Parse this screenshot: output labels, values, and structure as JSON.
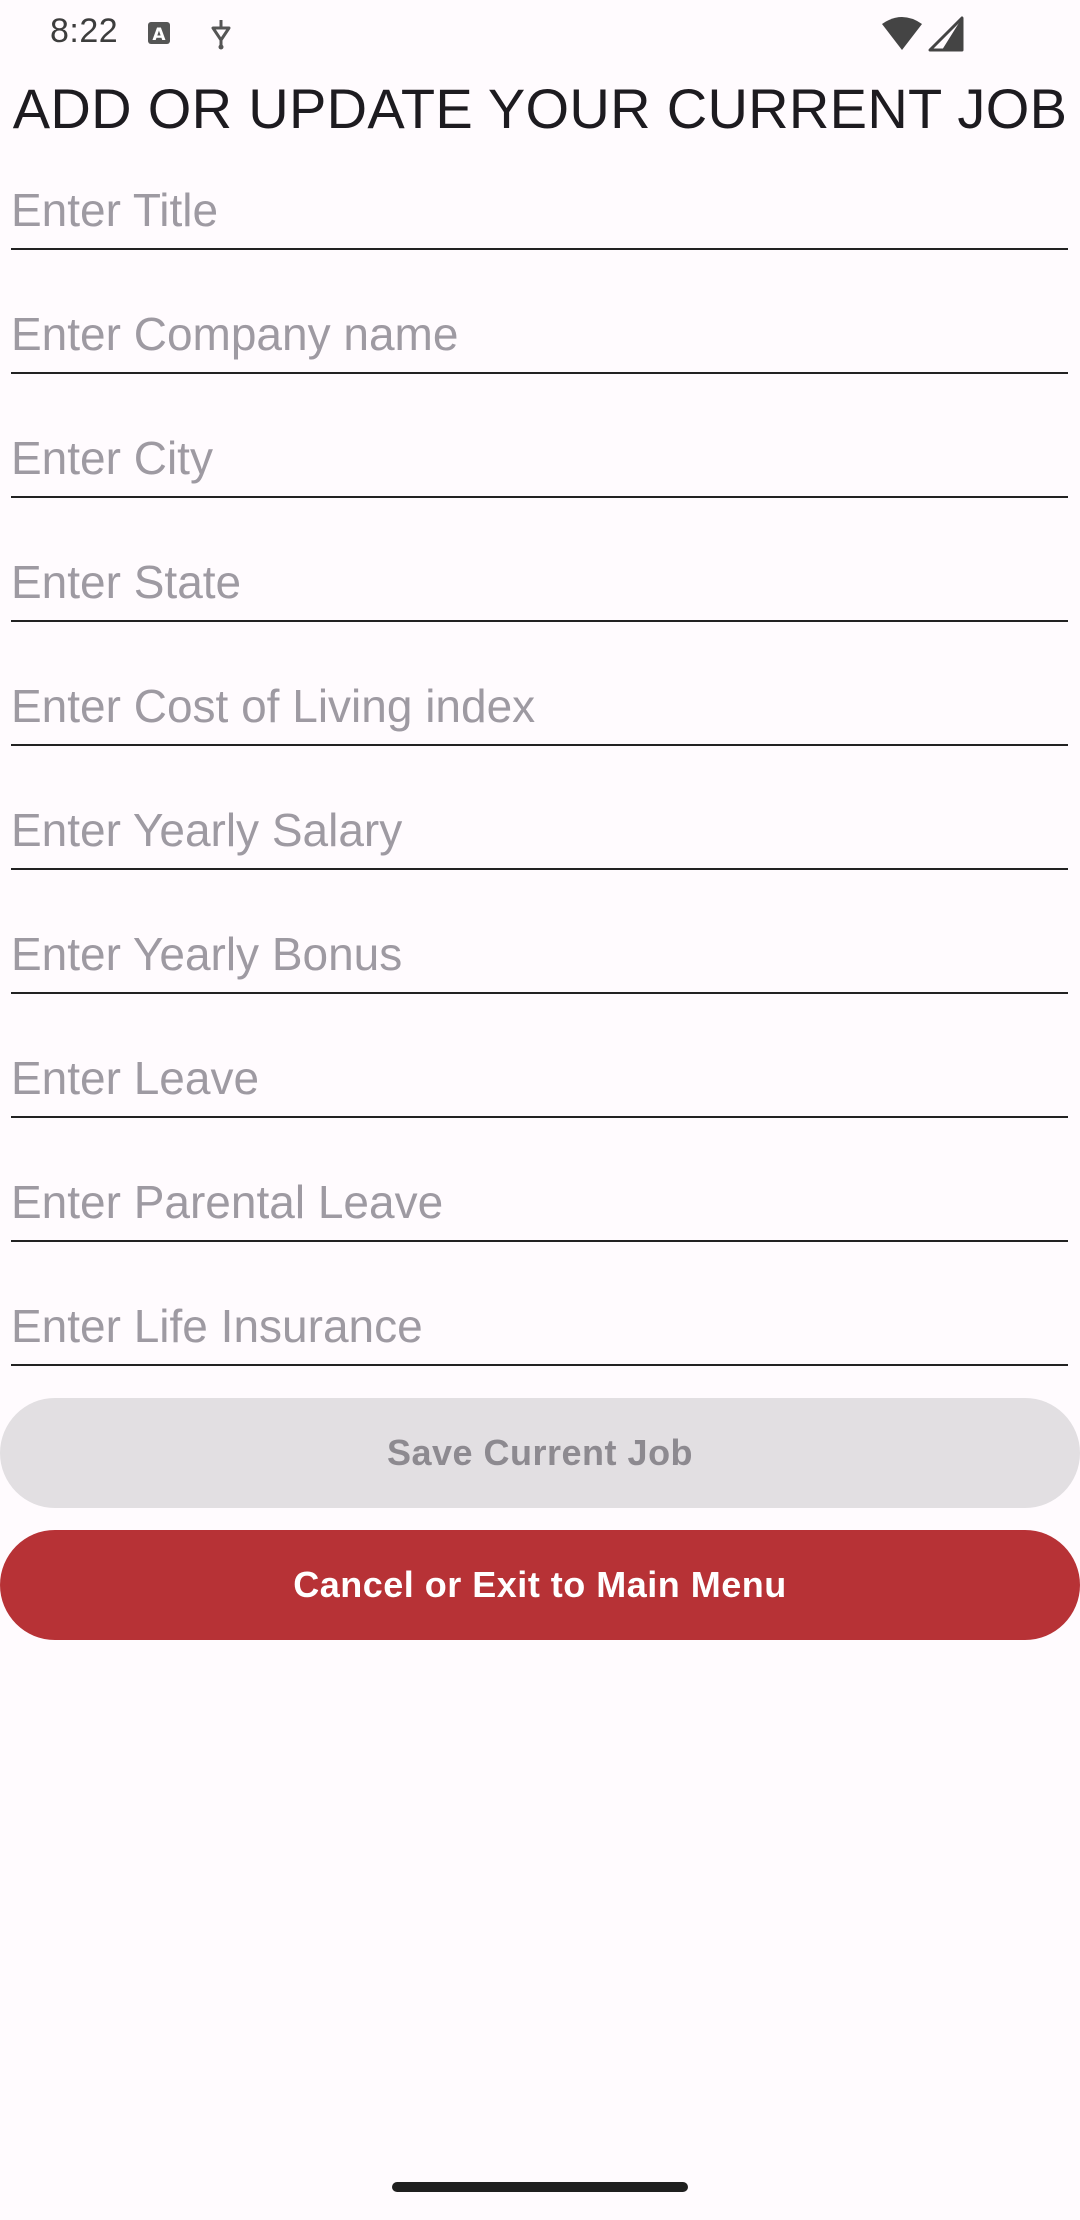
{
  "status_bar": {
    "time": "8:22",
    "icons": [
      "font-a-icon",
      "usb-debug-icon",
      "wifi-icon",
      "signal-icon"
    ]
  },
  "page": {
    "title": "ADD OR UPDATE YOUR CURRENT JOB"
  },
  "form": {
    "title": {
      "placeholder": "Enter Title",
      "value": ""
    },
    "company": {
      "placeholder": "Enter Company name",
      "value": ""
    },
    "city": {
      "placeholder": "Enter City",
      "value": ""
    },
    "state": {
      "placeholder": "Enter State",
      "value": ""
    },
    "cost_of_living": {
      "placeholder": "Enter Cost of Living index",
      "value": ""
    },
    "salary": {
      "placeholder": "Enter Yearly Salary",
      "value": ""
    },
    "bonus": {
      "placeholder": "Enter Yearly Bonus",
      "value": ""
    },
    "leave": {
      "placeholder": "Enter Leave",
      "value": ""
    },
    "parental_leave": {
      "placeholder": "Enter Parental Leave",
      "value": ""
    },
    "life_insurance": {
      "placeholder": "Enter Life Insurance",
      "value": ""
    }
  },
  "buttons": {
    "save_label": "Save Current Job",
    "cancel_label": "Cancel or Exit to Main Menu"
  },
  "colors": {
    "background": "#FFFBFE",
    "cancel_button": "#B73236",
    "save_button_disabled": "#E2DFE2",
    "placeholder_text": "#9E9AA2"
  }
}
